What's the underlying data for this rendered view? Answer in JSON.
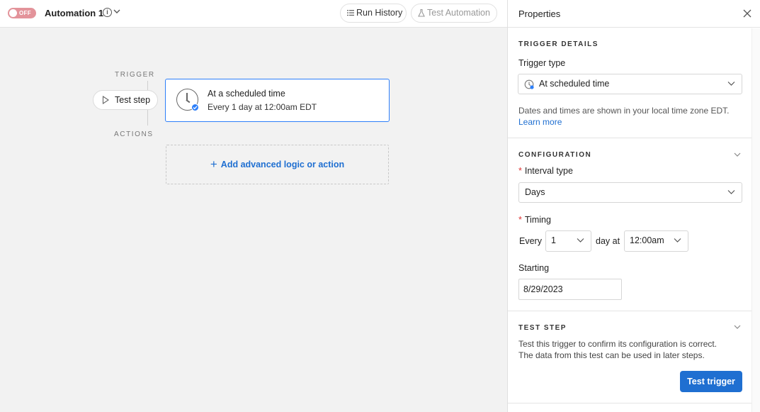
{
  "topbar": {
    "toggle_label": "OFF",
    "automation_name": "Automation 1",
    "info_glyph": "i",
    "run_history_label": "Run History",
    "test_automation_label": "Test Automation"
  },
  "canvas": {
    "trigger_section_label": "TRIGGER",
    "actions_section_label": "ACTIONS",
    "test_step_label": "Test step",
    "trigger_card": {
      "title": "At a scheduled time",
      "subtitle": "Every 1 day at 12:00am EDT"
    },
    "add_action_plus": "+",
    "add_action_label": "Add advanced logic or action"
  },
  "panel": {
    "title": "Properties",
    "trigger_details": {
      "title": "TRIGGER DETAILS",
      "trigger_type_label": "Trigger type",
      "trigger_type_value": "At scheduled time",
      "help_text": "Dates and times are shown in your local time zone EDT.",
      "learn_more": "Learn more"
    },
    "configuration": {
      "title": "CONFIGURATION",
      "required_mark": "*",
      "interval_type_label": "Interval type",
      "interval_type_value": "Days",
      "timing_label": "Timing",
      "every_label": "Every",
      "every_value": "1",
      "day_at_label": "day at",
      "time_value": "12:00am",
      "starting_label": "Starting",
      "starting_value": "8/29/2023"
    },
    "test_step": {
      "title": "TEST STEP",
      "help_line1": "Test this trigger to confirm its configuration is correct.",
      "help_line2": "The data from this test can be used in later steps.",
      "button_label": "Test trigger"
    }
  },
  "colors": {
    "accent": "#1f6fd1",
    "card_border": "#2d7ff9",
    "toggle_off": "#e3939a"
  }
}
